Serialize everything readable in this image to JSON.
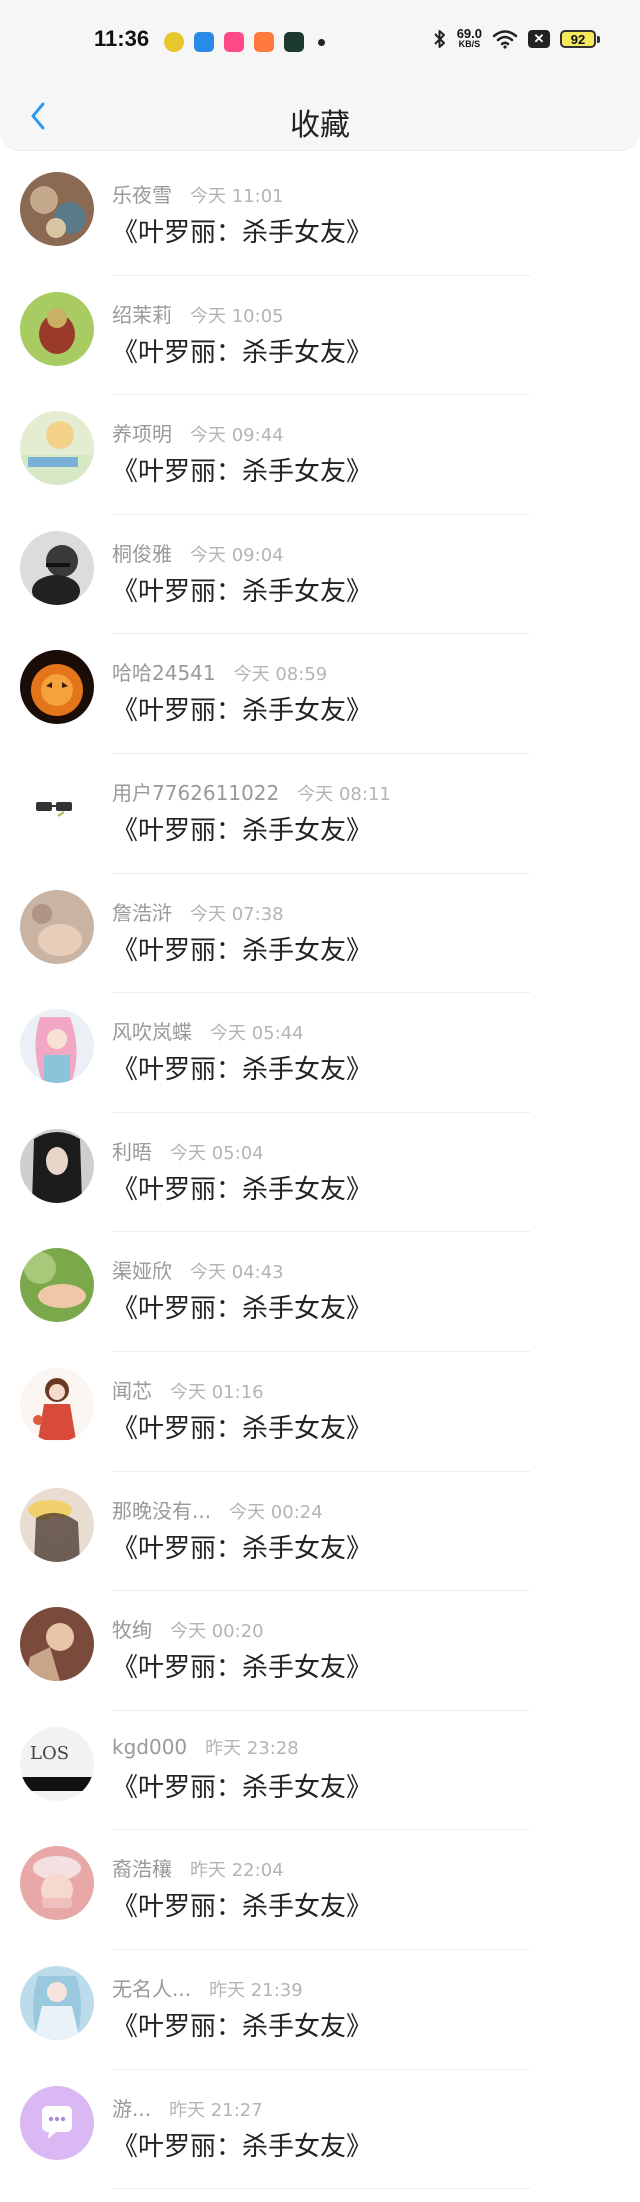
{
  "status_bar": {
    "time": "11:36",
    "speed_value": "69.0",
    "speed_unit": "KB/S",
    "battery": "92"
  },
  "header": {
    "title": "收藏"
  },
  "items": [
    {
      "name": "乐夜雪",
      "time": "今天 11:01",
      "content": "《叶罗丽：杀手女友》"
    },
    {
      "name": "绍茉莉",
      "time": "今天 10:05",
      "content": "《叶罗丽：杀手女友》"
    },
    {
      "name": "养项明",
      "time": "今天 09:44",
      "content": "《叶罗丽：杀手女友》"
    },
    {
      "name": "桐俊雅",
      "time": "今天 09:04",
      "content": "《叶罗丽：杀手女友》"
    },
    {
      "name": "哈哈24541",
      "time": "今天 08:59",
      "content": "《叶罗丽：杀手女友》"
    },
    {
      "name": "用户7762611022",
      "time": "今天 08:11",
      "content": "《叶罗丽：杀手女友》"
    },
    {
      "name": "詹浩浒",
      "time": "今天 07:38",
      "content": "《叶罗丽：杀手女友》"
    },
    {
      "name": "风吹岚蝶",
      "time": "今天 05:44",
      "content": "《叶罗丽：杀手女友》"
    },
    {
      "name": "利晤",
      "time": "今天 05:04",
      "content": "《叶罗丽：杀手女友》"
    },
    {
      "name": "渠娅欣",
      "time": "今天 04:43",
      "content": "《叶罗丽：杀手女友》"
    },
    {
      "name": "闻芯",
      "time": "今天 01:16",
      "content": "《叶罗丽：杀手女友》"
    },
    {
      "name": "那晚没有...",
      "time": "今天 00:24",
      "content": "《叶罗丽：杀手女友》"
    },
    {
      "name": "牧绚",
      "time": "今天 00:20",
      "content": "《叶罗丽：杀手女友》"
    },
    {
      "name": "kgd000",
      "time": "昨天 23:28",
      "content": "《叶罗丽：杀手女友》"
    },
    {
      "name": "裔浩穰",
      "time": "昨天 22:04",
      "content": "《叶罗丽：杀手女友》"
    },
    {
      "name": "无名人...",
      "time": "昨天 21:39",
      "content": "《叶罗丽：杀手女友》"
    },
    {
      "name": "游...",
      "time": "昨天 21:27",
      "content": "《叶罗丽：杀手女友》"
    }
  ],
  "colors": {
    "accent": "#2f9be8",
    "name": "#999999",
    "time": "#b4b4b4",
    "content": "#222222"
  }
}
